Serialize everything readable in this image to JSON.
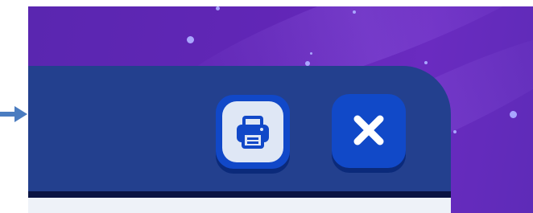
{
  "window": {
    "background_colors": [
      "#5a26b0",
      "#6a2bc0"
    ],
    "panel_color": "#23408e",
    "accent_color": "#1149c8"
  },
  "pointer": {
    "icon": "arrow-right-icon",
    "color": "#4a7cc0"
  },
  "toolbar": {
    "print_button": {
      "icon": "printer-icon"
    },
    "close_button": {
      "icon": "close-icon"
    }
  }
}
